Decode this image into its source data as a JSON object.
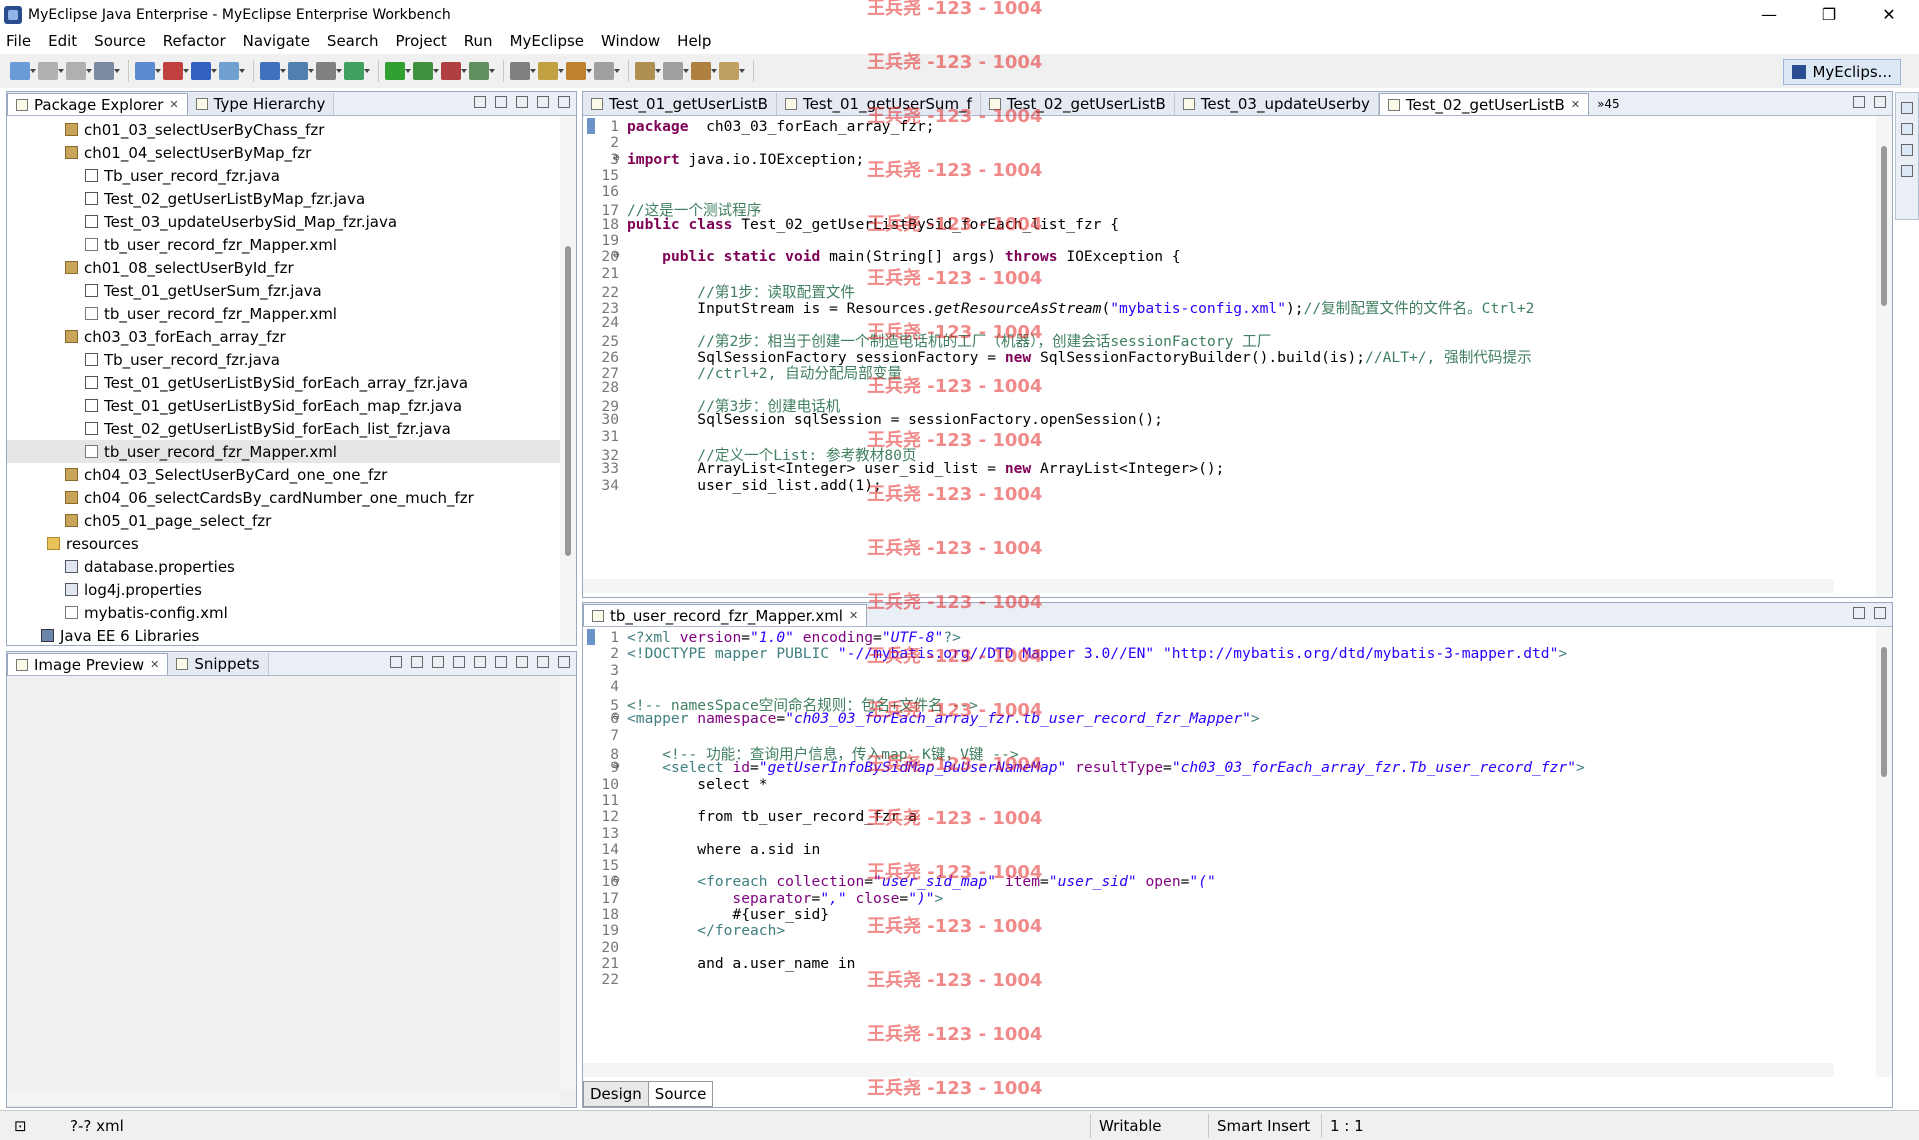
{
  "window": {
    "title": "MyEclipse Java Enterprise - MyEclipse Enterprise Workbench",
    "minimize": "—",
    "maximize": "❐",
    "close": "✕"
  },
  "menu": [
    "File",
    "Edit",
    "Source",
    "Refactor",
    "Navigate",
    "Search",
    "Project",
    "Run",
    "MyEclipse",
    "Window",
    "Help"
  ],
  "perspective_label": "MyEclips...",
  "package_explorer": {
    "tabs": [
      "Package Explorer",
      "Type Hierarchy"
    ],
    "items": [
      {
        "label": "ch01_03_selectUserByChass_fzr",
        "kind": "pkg",
        "indent": 1
      },
      {
        "label": "ch01_04_selectUserByMap_fzr",
        "kind": "pkg",
        "indent": 1
      },
      {
        "label": "Tb_user_record_fzr.java",
        "kind": "java",
        "indent": 2
      },
      {
        "label": "Test_02_getUserListByMap_fzr.java",
        "kind": "java",
        "indent": 2
      },
      {
        "label": "Test_03_updateUserbySid_Map_fzr.java",
        "kind": "java",
        "indent": 2
      },
      {
        "label": "tb_user_record_fzr_Mapper.xml",
        "kind": "xml",
        "indent": 2
      },
      {
        "label": "ch01_08_selectUserById_fzr",
        "kind": "pkg",
        "indent": 1
      },
      {
        "label": "Test_01_getUserSum_fzr.java",
        "kind": "java",
        "indent": 2
      },
      {
        "label": "tb_user_record_fzr_Mapper.xml",
        "kind": "xml",
        "indent": 2
      },
      {
        "label": "ch03_03_forEach_array_fzr",
        "kind": "pkg",
        "indent": 1
      },
      {
        "label": "Tb_user_record_fzr.java",
        "kind": "java",
        "indent": 2
      },
      {
        "label": "Test_01_getUserListBySid_forEach_array_fzr.java",
        "kind": "java",
        "indent": 2
      },
      {
        "label": "Test_01_getUserListBySid_forEach_map_fzr.java",
        "kind": "java",
        "indent": 2
      },
      {
        "label": "Test_02_getUserListBySid_forEach_list_fzr.java",
        "kind": "java",
        "indent": 2
      },
      {
        "label": "tb_user_record_fzr_Mapper.xml",
        "kind": "xml",
        "indent": 2,
        "selected": true
      },
      {
        "label": "ch04_03_SelectUserByCard_one_one_fzr",
        "kind": "pkg",
        "indent": 1
      },
      {
        "label": "ch04_06_selectCardsBy_cardNumber_one_much_fzr",
        "kind": "pkg",
        "indent": 1
      },
      {
        "label": "ch05_01_page_select_fzr",
        "kind": "pkg",
        "indent": 1
      },
      {
        "label": "resources",
        "kind": "folder",
        "indent": 0
      },
      {
        "label": "database.properties",
        "kind": "props",
        "indent": 1
      },
      {
        "label": "log4j.properties",
        "kind": "props",
        "indent": 1
      },
      {
        "label": "mybatis-config.xml",
        "kind": "xml",
        "indent": 1
      },
      {
        "label": "Java EE 6 Libraries",
        "kind": "lib",
        "indent": -1
      }
    ]
  },
  "image_preview": {
    "tabs": [
      "Image Preview",
      "Snippets"
    ]
  },
  "java_editor": {
    "tabs": [
      "Test_01_getUserListB",
      "Test_01_getUserSum_f",
      "Test_02_getUserListB",
      "Test_03_updateUserby",
      "Test_02_getUserListB"
    ],
    "active_tab": 4,
    "overflow": "»45",
    "lines": [
      {
        "n": "1",
        "segs": [
          [
            "kw",
            "package"
          ],
          [
            "",
            "  ch03_03_forEach_array_fzr;"
          ]
        ]
      },
      {
        "n": "2",
        "segs": []
      },
      {
        "n": "3",
        "fold": "⊕",
        "segs": [
          [
            "kw",
            "import"
          ],
          [
            "",
            " java.io.IOException;"
          ]
        ]
      },
      {
        "n": "15",
        "segs": []
      },
      {
        "n": "16",
        "segs": []
      },
      {
        "n": "17",
        "segs": [
          [
            "cm",
            "//这是一个测试程序"
          ]
        ]
      },
      {
        "n": "18",
        "segs": [
          [
            "kw",
            "public class"
          ],
          [
            "",
            " Test_02_getUserListBySid_forEach_list_fzr {"
          ]
        ]
      },
      {
        "n": "19",
        "segs": []
      },
      {
        "n": "20",
        "fold": "⊖",
        "segs": [
          [
            "",
            "    "
          ],
          [
            "kw",
            "public static void"
          ],
          [
            "",
            " main(String[] args) "
          ],
          [
            "kw",
            "throws"
          ],
          [
            "",
            " IOException {"
          ]
        ]
      },
      {
        "n": "21",
        "segs": []
      },
      {
        "n": "22",
        "segs": [
          [
            "",
            "        "
          ],
          [
            "cm",
            "//第1步：读取配置文件"
          ]
        ]
      },
      {
        "n": "23",
        "segs": [
          [
            "",
            "        InputStream is = Resources."
          ],
          [
            "it",
            "getResourceAsStream"
          ],
          [
            "",
            "("
          ],
          [
            "str",
            "\"mybatis-config.xml\""
          ],
          [
            "",
            ");"
          ],
          [
            "cm",
            "//复制配置文件的文件名。Ctrl+2"
          ]
        ]
      },
      {
        "n": "24",
        "segs": []
      },
      {
        "n": "25",
        "segs": [
          [
            "",
            "        "
          ],
          [
            "cm",
            "//第2步：相当于创建一个制造电话机的工厂（机器），创建会话sessionFactory 工厂"
          ]
        ]
      },
      {
        "n": "26",
        "segs": [
          [
            "",
            "        SqlSessionFactory sessionFactory = "
          ],
          [
            "kw",
            "new"
          ],
          [
            "",
            " SqlSessionFactoryBuilder().build(is);"
          ],
          [
            "cm",
            "//ALT+/, 强制代码提示"
          ]
        ]
      },
      {
        "n": "27",
        "segs": [
          [
            "",
            "        "
          ],
          [
            "cm",
            "//ctrl+2, 自动分配局部变量"
          ]
        ]
      },
      {
        "n": "28",
        "segs": []
      },
      {
        "n": "29",
        "segs": [
          [
            "",
            "        "
          ],
          [
            "cm",
            "//第3步：创建电话机"
          ]
        ]
      },
      {
        "n": "30",
        "segs": [
          [
            "",
            "        SqlSession sqlSession = sessionFactory.openSession();"
          ]
        ]
      },
      {
        "n": "31",
        "segs": []
      },
      {
        "n": "32",
        "segs": [
          [
            "",
            "        "
          ],
          [
            "cm",
            "//定义一个List: 参考教材80页"
          ]
        ]
      },
      {
        "n": "33",
        "segs": [
          [
            "",
            "        ArrayList<Integer> user_sid_list = "
          ],
          [
            "kw",
            "new"
          ],
          [
            "",
            " ArrayList<Integer>();"
          ]
        ]
      },
      {
        "n": "34",
        "segs": [
          [
            "",
            "        user_sid_list.add(1);"
          ]
        ]
      }
    ]
  },
  "xml_editor": {
    "tab": "tb_user_record_fzr_Mapper.xml",
    "bottom_tabs": [
      "Design",
      "Source"
    ],
    "lines": [
      {
        "n": "1",
        "segs": [
          [
            "tag",
            "<?xml"
          ],
          [
            "attr",
            " version"
          ],
          [
            "",
            "="
          ],
          [
            "aval",
            "\"1.0\""
          ],
          [
            "attr",
            " encoding"
          ],
          [
            "",
            "="
          ],
          [
            "aval",
            "\"UTF-8\""
          ],
          [
            "tag",
            "?>"
          ]
        ]
      },
      {
        "n": "2",
        "segs": [
          [
            "tag",
            "<!DOCTYPE mapper PUBLIC "
          ],
          [
            "str",
            "\"-//mybatis.org//DTD Mapper 3.0//EN\""
          ],
          [
            "",
            " "
          ],
          [
            "str",
            "\"http://mybatis.org/dtd/mybatis-3-mapper.dtd\""
          ],
          [
            "tag",
            ">"
          ]
        ]
      },
      {
        "n": "3",
        "segs": []
      },
      {
        "n": "4",
        "segs": []
      },
      {
        "n": "5",
        "segs": [
          [
            "cm",
            "<!-- namesSpace空间命名规则：包名+文件名 -->"
          ]
        ]
      },
      {
        "n": "6",
        "fold": "⊖",
        "segs": [
          [
            "tag",
            "<mapper"
          ],
          [
            "attr",
            " namespace"
          ],
          [
            "",
            "="
          ],
          [
            "aval",
            "\"ch03_03_forEach_array_fzr.tb_user_record_fzr_Mapper\""
          ],
          [
            "tag",
            ">"
          ]
        ]
      },
      {
        "n": "7",
        "segs": []
      },
      {
        "n": "8",
        "segs": [
          [
            "",
            "    "
          ],
          [
            "cm",
            "<!-- 功能：查询用户信息，传入map：K键，V键 -->"
          ]
        ]
      },
      {
        "n": "9",
        "fold": "⊖",
        "segs": [
          [
            "",
            "    "
          ],
          [
            "tag",
            "<select"
          ],
          [
            "attr",
            " id"
          ],
          [
            "",
            "="
          ],
          [
            "aval",
            "\"getUserInfoBySidMap_BuUserNameMap\""
          ],
          [
            "attr",
            " resultType"
          ],
          [
            "",
            "="
          ],
          [
            "aval",
            "\"ch03_03_forEach_array_fzr.Tb_user_record_fzr\""
          ],
          [
            "tag",
            ">"
          ]
        ]
      },
      {
        "n": "10",
        "segs": [
          [
            "",
            "        select *"
          ]
        ]
      },
      {
        "n": "11",
        "segs": []
      },
      {
        "n": "12",
        "segs": [
          [
            "",
            "        from tb_user_record_fzr a"
          ]
        ]
      },
      {
        "n": "13",
        "segs": []
      },
      {
        "n": "14",
        "segs": [
          [
            "",
            "        where a.sid in"
          ]
        ]
      },
      {
        "n": "15",
        "segs": []
      },
      {
        "n": "16",
        "fold": "⊖",
        "segs": [
          [
            "",
            "        "
          ],
          [
            "tag",
            "<foreach"
          ],
          [
            "attr",
            " collection"
          ],
          [
            "",
            "="
          ],
          [
            "aval",
            "\"user_sid_map\""
          ],
          [
            "attr",
            " item"
          ],
          [
            "",
            "="
          ],
          [
            "aval",
            "\"user_sid\""
          ],
          [
            "attr",
            " open"
          ],
          [
            "",
            "="
          ],
          [
            "aval",
            "\"(\""
          ]
        ]
      },
      {
        "n": "17",
        "segs": [
          [
            "attr",
            "            separator"
          ],
          [
            "",
            "="
          ],
          [
            "aval",
            "\",\""
          ],
          [
            "attr",
            " close"
          ],
          [
            "",
            "="
          ],
          [
            "aval",
            "\")\""
          ],
          [
            "tag",
            ">"
          ]
        ]
      },
      {
        "n": "18",
        "segs": [
          [
            "",
            "            #{user_sid}"
          ]
        ]
      },
      {
        "n": "19",
        "segs": [
          [
            "",
            "        "
          ],
          [
            "tag",
            "</foreach>"
          ]
        ]
      },
      {
        "n": "20",
        "segs": []
      },
      {
        "n": "21",
        "segs": [
          [
            "",
            "        and a.user_name in"
          ]
        ]
      },
      {
        "n": "22",
        "segs": []
      }
    ]
  },
  "watermark": "王兵尧 -123 - 1004",
  "status": {
    "file": "?-? xml",
    "writable": "Writable",
    "insert": "Smart Insert",
    "position": "1 : 1"
  }
}
